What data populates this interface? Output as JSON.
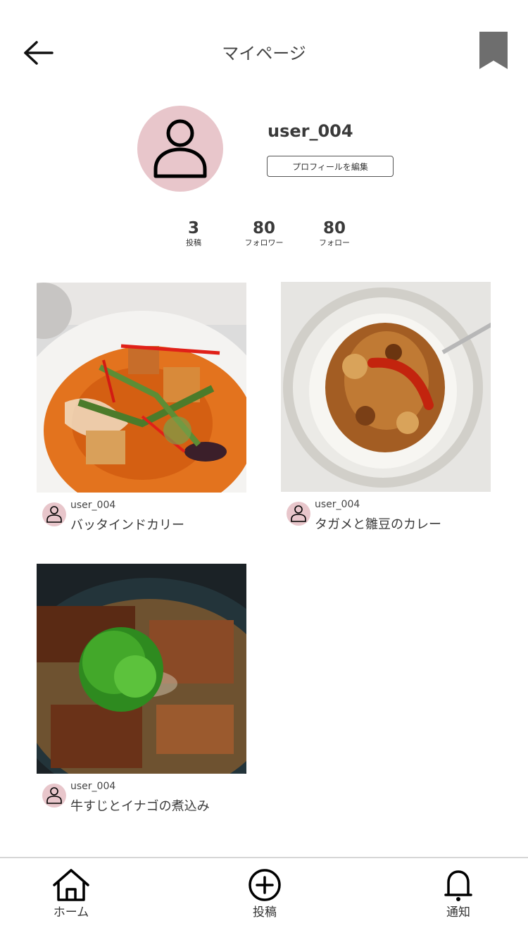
{
  "header": {
    "title": "マイページ",
    "back_icon": "arrow-left-icon",
    "bookmark_icon": "bookmark-icon"
  },
  "profile": {
    "username": "user_004",
    "edit_label": "プロフィールを編集",
    "avatar_icon": "person-icon",
    "avatar_color": "#e8c6cb"
  },
  "stats": [
    {
      "value": "3",
      "label": "投稿"
    },
    {
      "value": "80",
      "label": "フォロワー"
    },
    {
      "value": "80",
      "label": "フォロー"
    }
  ],
  "posts": [
    {
      "user": "user_004",
      "title": "バッタインドカリー"
    },
    {
      "user": "user_004",
      "title": "タガメと雛豆のカレー"
    },
    {
      "user": "user_004",
      "title": "牛すじとイナゴの煮込み"
    }
  ],
  "nav": [
    {
      "label": "ホーム",
      "icon": "home-icon"
    },
    {
      "label": "投稿",
      "icon": "plus-circle-icon"
    },
    {
      "label": "通知",
      "icon": "bell-icon"
    }
  ]
}
